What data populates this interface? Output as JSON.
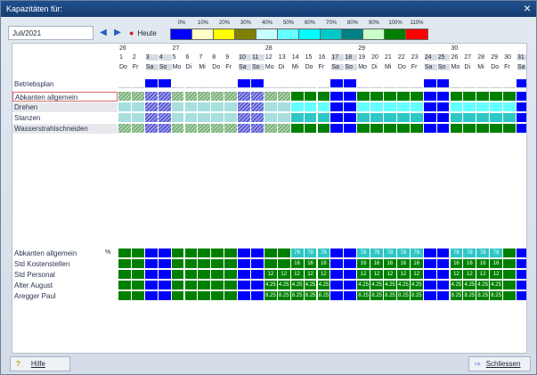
{
  "window": {
    "title": "Kapazitäten für:",
    "close_icon": "×"
  },
  "toolbar": {
    "month": "Juli/2021",
    "prev_icon": "◀",
    "next_icon": "▶",
    "today_label": "Heute",
    "today_icon": "●"
  },
  "legend": [
    {
      "label": "0%",
      "color": "#0000ff"
    },
    {
      "label": "10%",
      "color": "#ffffc8"
    },
    {
      "label": "20%",
      "color": "#ffff00"
    },
    {
      "label": "30%",
      "color": "#808000"
    },
    {
      "label": "40%",
      "color": "#c8ffff"
    },
    {
      "label": "50%",
      "color": "#64ffff"
    },
    {
      "label": "60%",
      "color": "#00ffff"
    },
    {
      "label": "70%",
      "color": "#00c8c8"
    },
    {
      "label": "80%",
      "color": "#008080"
    },
    {
      "label": "90%",
      "color": "#c8ffc8"
    },
    {
      "label": "100%",
      "color": "#008000"
    },
    {
      "label": "110%",
      "color": "#ff0000"
    }
  ],
  "calendar": {
    "weeks": [
      {
        "label": "26",
        "day_index": 0
      },
      {
        "label": "27",
        "day_index": 4
      },
      {
        "label": "28",
        "day_index": 11
      },
      {
        "label": "29",
        "day_index": 18
      },
      {
        "label": "30",
        "day_index": 25
      }
    ],
    "days": [
      "1",
      "2",
      "3",
      "4",
      "5",
      "6",
      "7",
      "8",
      "9",
      "10",
      "11",
      "12",
      "13",
      "14",
      "15",
      "16",
      "17",
      "18",
      "19",
      "20",
      "21",
      "22",
      "23",
      "24",
      "25",
      "26",
      "27",
      "28",
      "29",
      "30",
      "31"
    ],
    "weekdays": [
      "Do",
      "Fr",
      "Sa",
      "So",
      "Mo",
      "Di",
      "Mi",
      "Do",
      "Fr",
      "Sa",
      "So",
      "Mo",
      "Di",
      "Mi",
      "Do",
      "Fr",
      "Sa",
      "So",
      "Mo",
      "Di",
      "Mi",
      "Do",
      "Fr",
      "Sa",
      "So",
      "Mo",
      "Di",
      "Mi",
      "Do",
      "Fr",
      "Sa"
    ],
    "weekend_days": [
      2,
      3,
      9,
      10,
      16,
      17,
      23,
      24,
      30
    ]
  },
  "plan_rows": [
    {
      "label": "Betriebsplan",
      "style": "plain",
      "pattern": "betriebsplan"
    },
    {
      "label": "Abkanten allgemein",
      "style": "sel",
      "pattern": "abkanten"
    },
    {
      "label": "Drehen",
      "style": "grey",
      "pattern": "drehen"
    },
    {
      "label": "Stanzen",
      "style": "plain",
      "pattern": "stanzen"
    },
    {
      "label": "Wasserstrahlschneiden",
      "style": "grey",
      "pattern": "wasser"
    }
  ],
  "resource_rows": [
    {
      "label": "Abkanten allgemein",
      "unit": "%",
      "value": "78",
      "filled_days": [
        13,
        14,
        15,
        18,
        19,
        20,
        21,
        22,
        25,
        26,
        27,
        28
      ]
    },
    {
      "label": "Std Kostenstellen",
      "unit": "",
      "value": "16",
      "filled_days": [
        13,
        14,
        15,
        18,
        19,
        20,
        21,
        22,
        25,
        26,
        27,
        28
      ]
    },
    {
      "label": "Std Personal",
      "unit": "",
      "value": "12",
      "filled_days": [
        11,
        12,
        13,
        14,
        15,
        18,
        19,
        20,
        21,
        22,
        25,
        26,
        27,
        28
      ]
    },
    {
      "label": "Alter August",
      "unit": "",
      "value": "4.25",
      "filled_days": [
        11,
        12,
        13,
        14,
        15,
        18,
        19,
        20,
        21,
        22,
        25,
        26,
        27,
        28
      ]
    },
    {
      "label": "Aregger Paul",
      "unit": "",
      "value": "8.25",
      "filled_days": [
        11,
        12,
        13,
        14,
        15,
        18,
        19,
        20,
        21,
        22,
        25,
        26,
        27,
        28
      ]
    }
  ],
  "colors": {
    "weekend": "#0000ff",
    "full": "#008000",
    "teal": "#2ec6c6",
    "light_teal": "#a7dede",
    "hatch_green": "#7ab27a",
    "hatch_blue": "#5b5bd6",
    "red": "#ff0000"
  },
  "footer": {
    "help_label": "Hilfe",
    "help_icon": "?",
    "close_label": "Schliessen",
    "close_icon": "⇨"
  }
}
